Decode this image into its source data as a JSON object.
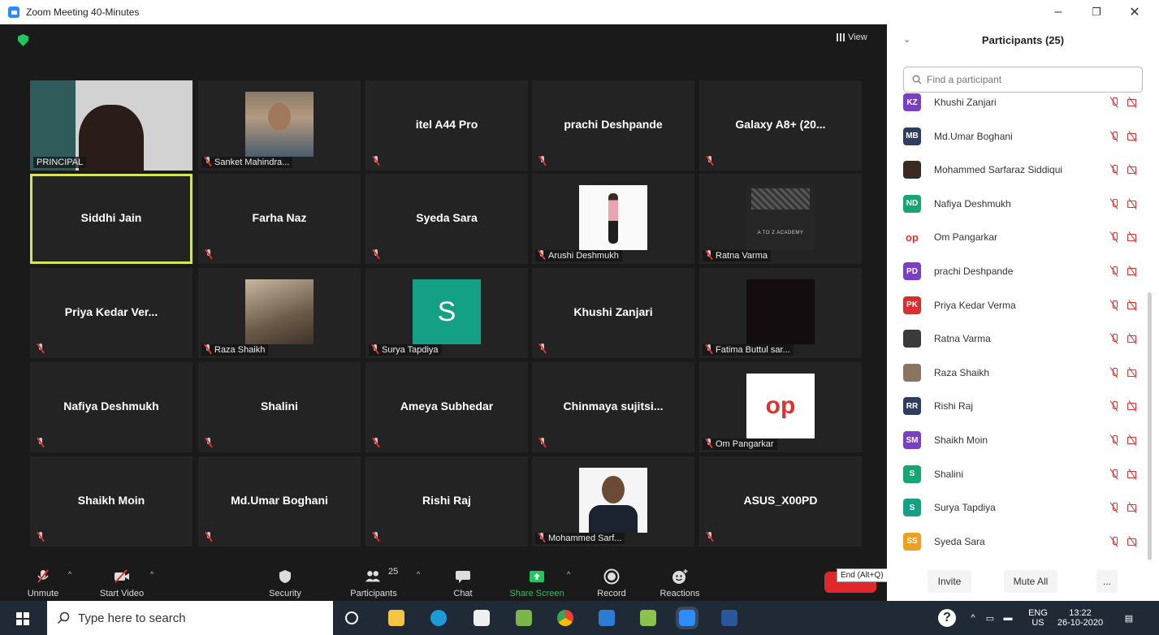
{
  "window": {
    "title": "Zoom Meeting 40-Minutes",
    "minimize": "–",
    "restore": "❐",
    "close": "✕"
  },
  "meeting": {
    "view_label": "View",
    "tiles": [
      {
        "id": "principal",
        "name": "PRINCIPAL",
        "style": "label-nomic",
        "pic": "principal"
      },
      {
        "id": "sanket",
        "name": "Sanket Mahindra...",
        "style": "label",
        "pic": "sanket"
      },
      {
        "id": "itel",
        "name": "itel A44 Pro",
        "style": "center"
      },
      {
        "id": "prachi",
        "name": "prachi Deshpande",
        "style": "center"
      },
      {
        "id": "galaxy",
        "name": "Galaxy A8+ (20...",
        "style": "center"
      },
      {
        "id": "siddhi",
        "name": "Siddhi Jain",
        "style": "center-nomic",
        "active": true
      },
      {
        "id": "farha",
        "name": "Farha Naz",
        "style": "center"
      },
      {
        "id": "syeda",
        "name": "Syeda Sara",
        "style": "center"
      },
      {
        "id": "arushi",
        "name": "Arushi Deshmukh",
        "style": "label",
        "pic": "arushi"
      },
      {
        "id": "ratna",
        "name": "Ratna Varma",
        "style": "label",
        "pic": "atoz",
        "pic_text": "A TO Z ACADEMY"
      },
      {
        "id": "priya",
        "name": "Priya Kedar Ver...",
        "style": "center"
      },
      {
        "id": "raza",
        "name": "Raza Shaikh",
        "style": "label",
        "pic": "raza"
      },
      {
        "id": "surya",
        "name": "Surya Tapdiya",
        "style": "label",
        "pic": "surya",
        "pic_text": "S"
      },
      {
        "id": "khushi",
        "name": "Khushi Zanjari",
        "style": "center"
      },
      {
        "id": "fatima",
        "name": "Fatima Buttul sar...",
        "style": "label",
        "pic": "fatima"
      },
      {
        "id": "nafiya",
        "name": "Nafiya Deshmukh",
        "style": "center"
      },
      {
        "id": "shalini",
        "name": "Shalini",
        "style": "center"
      },
      {
        "id": "ameya",
        "name": "Ameya Subhedar",
        "style": "center"
      },
      {
        "id": "chinmaya",
        "name": "Chinmaya  sujitsi...",
        "style": "center"
      },
      {
        "id": "om",
        "name": "Om Pangarkar",
        "style": "label",
        "pic": "om",
        "pic_text": "op"
      },
      {
        "id": "shaikh",
        "name": "Shaikh Moin",
        "style": "center"
      },
      {
        "id": "umar",
        "name": "Md.Umar Boghani",
        "style": "center"
      },
      {
        "id": "rishi",
        "name": "Rishi Raj",
        "style": "center"
      },
      {
        "id": "sarf",
        "name": "Mohammed Sarf...",
        "style": "label",
        "pic": "sarf"
      },
      {
        "id": "asus",
        "name": "ASUS_X00PD",
        "style": "center"
      }
    ]
  },
  "toolbar": {
    "unmute": "Unmute",
    "start_video": "Start Video",
    "security": "Security",
    "participants": "Participants",
    "participants_count": "25",
    "chat": "Chat",
    "share_screen": "Share Screen",
    "record": "Record",
    "reactions": "Reactions",
    "end_tooltip": "End (Alt+Q)"
  },
  "panel": {
    "title": "Participants (25)",
    "search_placeholder": "Find a participant",
    "participants": [
      {
        "initials": "KZ",
        "name": "Khushi Zanjari",
        "color": "#7b3fc4"
      },
      {
        "initials": "MB",
        "name": "Md.Umar Boghani",
        "color": "#2d3f5c"
      },
      {
        "initials": "",
        "name": "Mohammed Sarfaraz Siddiqui",
        "color": "#3b2a22"
      },
      {
        "initials": "ND",
        "name": "Nafiya Deshmukh",
        "color": "#17a673"
      },
      {
        "initials": "op",
        "name": "Om Pangarkar",
        "color": "#ffffff"
      },
      {
        "initials": "PD",
        "name": "prachi Deshpande",
        "color": "#7b3fc4"
      },
      {
        "initials": "PK",
        "name": "Priya Kedar Verma",
        "color": "#d63031"
      },
      {
        "initials": "",
        "name": "Ratna Varma",
        "color": "#3a3a3a"
      },
      {
        "initials": "",
        "name": "Raza Shaikh",
        "color": "#8a7660"
      },
      {
        "initials": "RR",
        "name": "Rishi Raj",
        "color": "#2d3f5c"
      },
      {
        "initials": "SM",
        "name": "Shaikh Moin",
        "color": "#7b3fc4"
      },
      {
        "initials": "S",
        "name": "Shalini",
        "color": "#17a673"
      },
      {
        "initials": "S",
        "name": "Surya Tapdiya",
        "color": "#14a085"
      },
      {
        "initials": "SS",
        "name": "Syeda Sara",
        "color": "#f0a020"
      }
    ],
    "invite": "Invite",
    "mute_all": "Mute All",
    "more": "..."
  },
  "taskbar": {
    "search_placeholder": "Type here to search",
    "lang_top": "ENG",
    "lang_bottom": "US",
    "time": "13:22",
    "date": "26-10-2020"
  }
}
